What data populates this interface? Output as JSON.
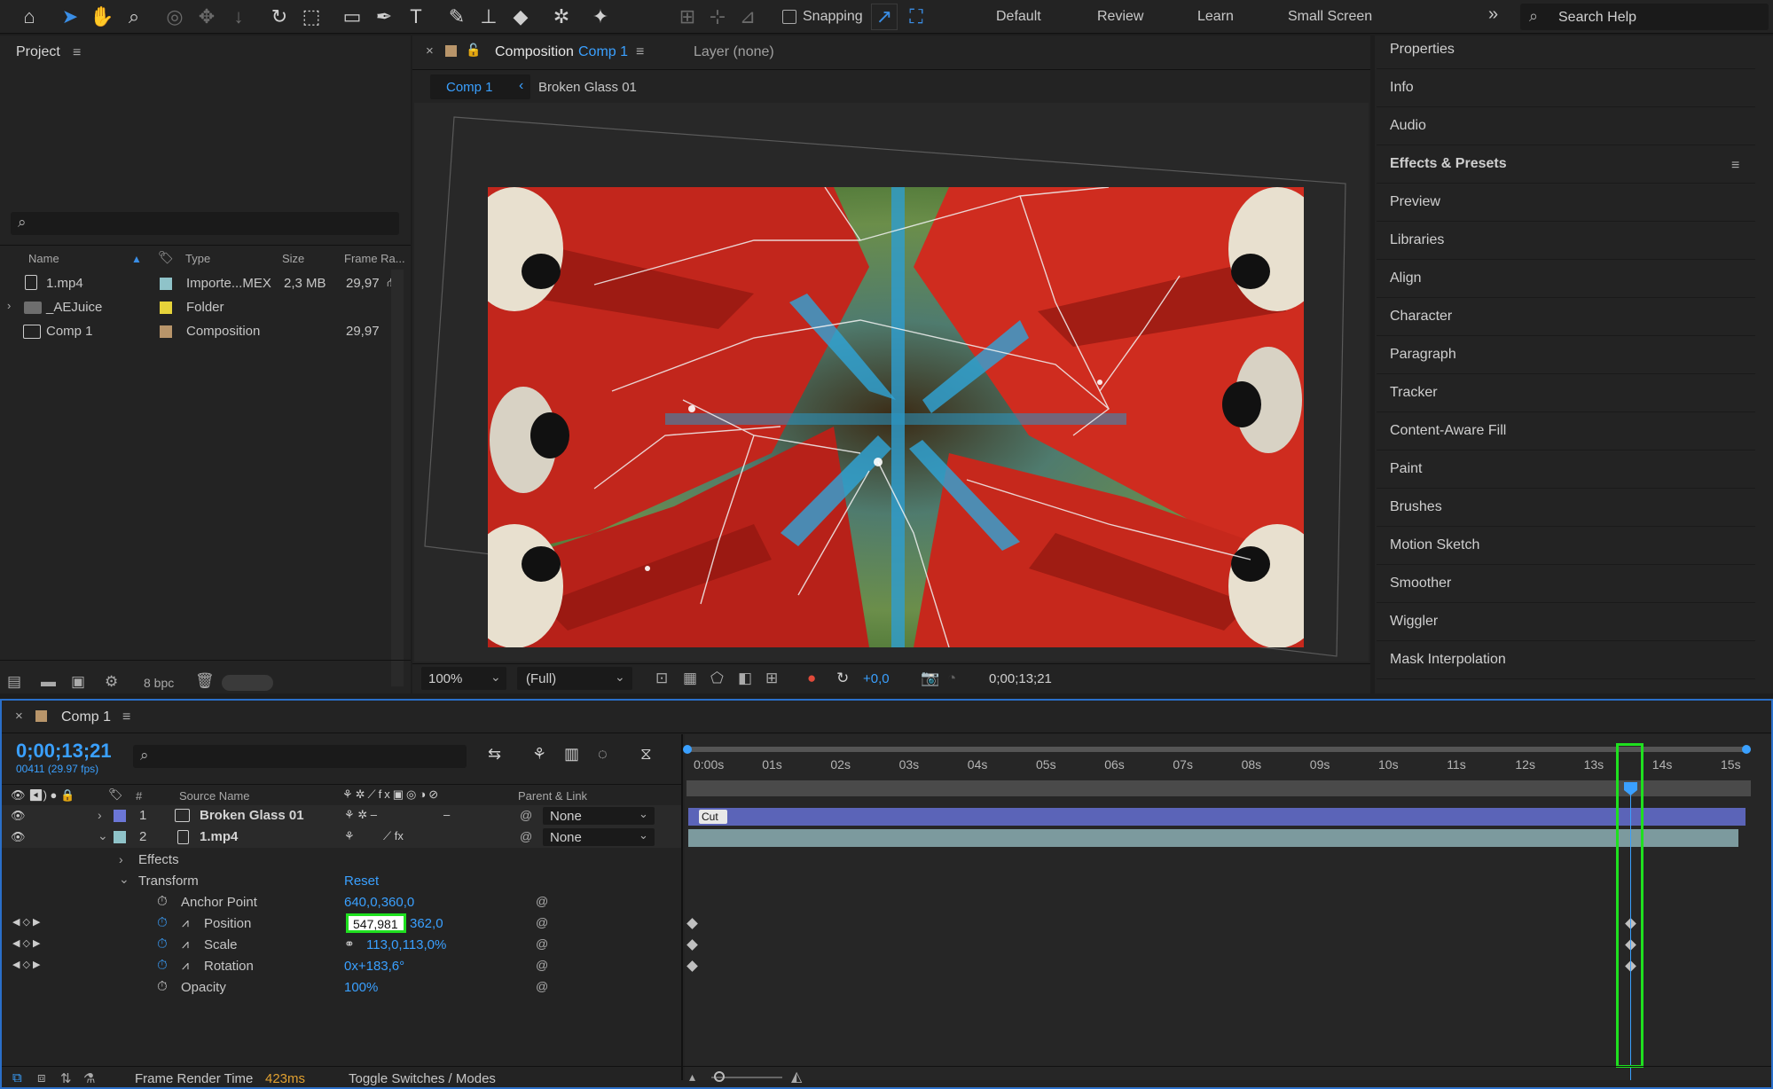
{
  "toolbar": {
    "snapping_label": "Snapping",
    "workspaces": [
      "Default",
      "Review",
      "Learn",
      "Small Screen"
    ],
    "more_label": "»",
    "search_placeholder": "Search Help"
  },
  "project": {
    "title": "Project",
    "search_placeholder": "",
    "columns": [
      "Name",
      "Type",
      "Size",
      "Frame Ra..."
    ],
    "items": [
      {
        "name": "1.mp4",
        "type": "Importe...MEX",
        "size": "2,3 MB",
        "fps": "29,97",
        "color": "#8fc3c9"
      },
      {
        "name": "_AEJuice",
        "type": "Folder",
        "size": "",
        "fps": "",
        "color": "#e6d33a"
      },
      {
        "name": "Comp 1",
        "type": "Composition",
        "size": "",
        "fps": "29,97",
        "color": "#b8956a"
      }
    ],
    "bpc": "8 bpc"
  },
  "composition": {
    "tab_title": "Composition",
    "tab_comp": "Comp 1",
    "layer_tab": "Layer (none)",
    "breadcrumb_comp": "Comp 1",
    "breadcrumb_layer": "Broken Glass 01",
    "zoom": "100%",
    "resolution": "(Full)",
    "exposure": "+0,0",
    "timecode": "0;00;13;21"
  },
  "right_panel": {
    "items": [
      "Properties",
      "Info",
      "Audio",
      "Effects & Presets",
      "Preview",
      "Libraries",
      "Align",
      "Character",
      "Paragraph",
      "Tracker",
      "Content-Aware Fill",
      "Paint",
      "Brushes",
      "Motion Sketch",
      "Smoother",
      "Wiggler",
      "Mask Interpolation"
    ]
  },
  "timeline": {
    "tab": "Comp 1",
    "timecode": "0;00;13;21",
    "frame_info": "00411 (29.97 fps)",
    "col_source": "Source Name",
    "col_num": "#",
    "col_parent": "Parent & Link",
    "layers": [
      {
        "num": "1",
        "name": "Broken Glass 01",
        "parent": "None",
        "color": "#6b76d6"
      },
      {
        "num": "2",
        "name": "1.mp4",
        "parent": "None",
        "color": "#8fc3c9"
      }
    ],
    "effects_label": "Effects",
    "transform_label": "Transform",
    "reset_label": "Reset",
    "props": [
      {
        "name": "Anchor Point",
        "value": "640,0,360,0"
      },
      {
        "name": "Position",
        "value_edit": "547,981",
        "value": "362,0"
      },
      {
        "name": "Scale",
        "value": "113,0,113,0%"
      },
      {
        "name": "Rotation",
        "value": "0x+183,6°"
      },
      {
        "name": "Opacity",
        "value": "100%"
      }
    ],
    "ruler": [
      "0:00s",
      "01s",
      "02s",
      "03s",
      "04s",
      "05s",
      "06s",
      "07s",
      "08s",
      "09s",
      "10s",
      "11s",
      "12s",
      "13s",
      "14s",
      "15s"
    ],
    "cut_label": "Cut",
    "render_label": "Frame Render Time",
    "render_value": "423ms",
    "toggle_label": "Toggle Switches / Modes"
  }
}
